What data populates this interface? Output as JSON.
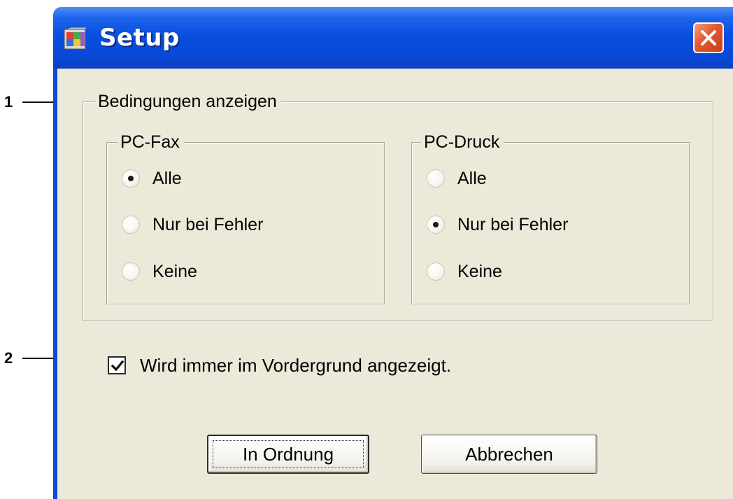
{
  "callouts": [
    {
      "number": "1"
    },
    {
      "number": "2"
    }
  ],
  "window": {
    "title": "Setup",
    "icon": "setup-app-icon",
    "close_icon": "close-icon"
  },
  "display_conditions": {
    "label": "Bedingungen anzeigen",
    "pc_fax": {
      "label": "PC-Fax",
      "options": [
        {
          "label": "Alle",
          "selected": true
        },
        {
          "label": "Nur bei Fehler",
          "selected": false
        },
        {
          "label": "Keine",
          "selected": false
        }
      ]
    },
    "pc_print": {
      "label": "PC-Druck",
      "options": [
        {
          "label": "Alle",
          "selected": false
        },
        {
          "label": "Nur bei Fehler",
          "selected": true
        },
        {
          "label": "Keine",
          "selected": false
        }
      ]
    }
  },
  "always_on_top": {
    "label": "Wird immer im Vordergrund angezeigt.",
    "checked": true
  },
  "buttons": {
    "ok_label": "In Ordnung",
    "cancel_label": "Abbrechen"
  },
  "colors": {
    "titlebar": "#0848d6",
    "client_bg": "#ece9d8",
    "close_button": "#e2582f"
  }
}
